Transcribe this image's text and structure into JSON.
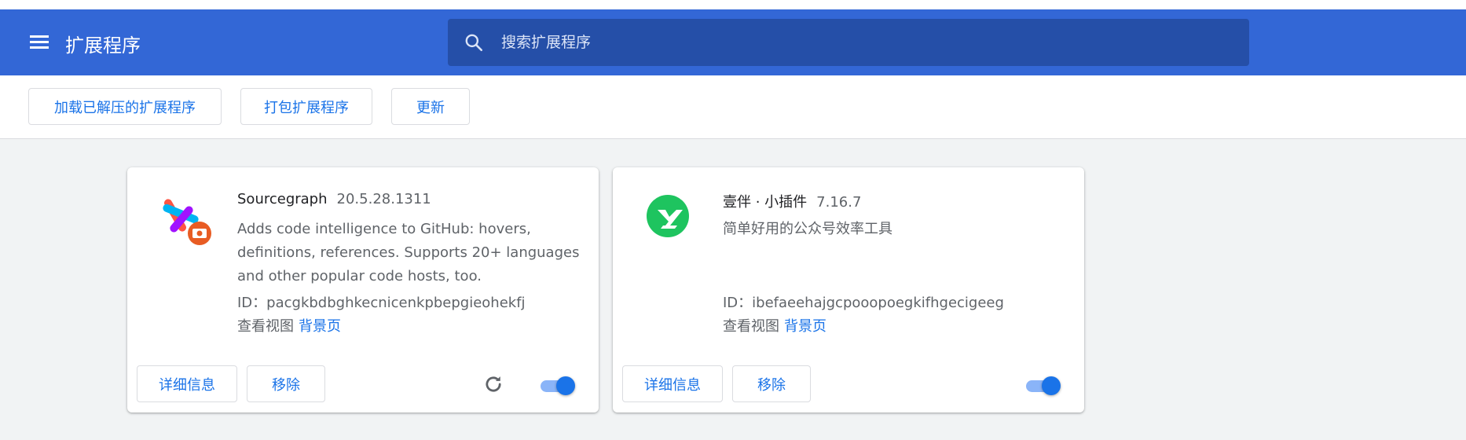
{
  "header": {
    "title": "扩展程序",
    "search_placeholder": "搜索扩展程序"
  },
  "toolbar": {
    "load_unpacked": "加载已解压的扩展程序",
    "pack": "打包扩展程序",
    "update": "更新"
  },
  "extensions": [
    {
      "name": "Sourcegraph",
      "version": "20.5.28.1311",
      "description": "Adds code intelligence to GitHub: hovers, definitions, references. Supports 20+ languages and other popular code hosts, too.",
      "id_line": "ID：pacgkbdbghkecnicenkpbepgieohekfj",
      "views_label": "查看视图",
      "views_link": "背景页",
      "details_label": "详细信息",
      "remove_label": "移除",
      "enabled": true
    },
    {
      "name": "壹伴 · 小插件",
      "version": "7.16.7",
      "description": "简单好用的公众号效率工具",
      "id_line": "ID：ibefaeehajgcpooopoegkifhgecigeeg",
      "views_label": "查看视图",
      "views_link": "背景页",
      "details_label": "详细信息",
      "remove_label": "移除",
      "enabled": true
    }
  ],
  "colors": {
    "header_bg": "#3367d6",
    "search_bg": "#254fa8",
    "accent": "#1a73e8",
    "toggle_track": "#8ab4f8",
    "page_bg": "#f1f3f4"
  },
  "icons": {
    "menu": "hamburger-menu-icon",
    "search": "search-icon",
    "reload": "reload-icon",
    "sourcegraph": "sourcegraph-logo-icon",
    "yiban": "yiban-logo-icon"
  }
}
